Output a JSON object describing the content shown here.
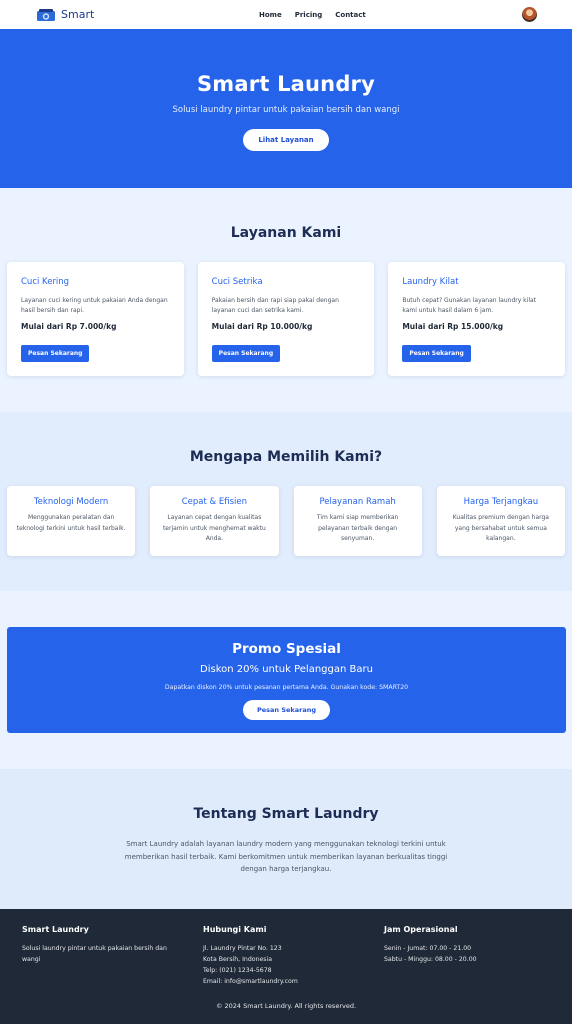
{
  "nav": {
    "brand": "Smart",
    "links": [
      "Home",
      "Pricing",
      "Contact"
    ]
  },
  "hero": {
    "title": "Smart Laundry",
    "subtitle": "Solusi laundry pintar untuk pakaian bersih dan wangi",
    "button": "Lihat Layanan"
  },
  "services": {
    "title": "Layanan Kami",
    "items": [
      {
        "name": "Cuci Kering",
        "desc": "Layanan cuci kering untuk pakaian Anda dengan hasil bersih dan rapi.",
        "price": "Mulai dari Rp 7.000/kg",
        "button": "Pesan Sekarang"
      },
      {
        "name": "Cuci Setrika",
        "desc": "Pakaian bersih dan rapi siap pakai dengan layanan cuci dan setrika kami.",
        "price": "Mulai dari Rp 10.000/kg",
        "button": "Pesan Sekarang"
      },
      {
        "name": "Laundry Kilat",
        "desc": "Butuh cepat? Gunakan layanan laundry kilat kami untuk hasil dalam 6 jam.",
        "price": "Mulai dari Rp 15.000/kg",
        "button": "Pesan Sekarang"
      }
    ]
  },
  "why": {
    "title": "Mengapa Memilih Kami?",
    "items": [
      {
        "name": "Teknologi Modern",
        "desc": "Menggunakan peralatan dan teknologi terkini untuk hasil terbaik."
      },
      {
        "name": "Cepat & Efisien",
        "desc": "Layanan cepat dengan kualitas terjamin untuk menghemat waktu Anda."
      },
      {
        "name": "Pelayanan Ramah",
        "desc": "Tim kami siap memberikan pelayanan terbaik dengan senyuman."
      },
      {
        "name": "Harga Terjangkau",
        "desc": "Kualitas premium dengan harga yang bersahabat untuk semua kalangan."
      }
    ]
  },
  "promo": {
    "title": "Promo Spesial",
    "subtitle": "Diskon 20% untuk Pelanggan Baru",
    "desc": "Dapatkan diskon 20% untuk pesanan pertama Anda. Gunakan kode: SMART20",
    "button": "Pesan Sekarang"
  },
  "about": {
    "title": "Tentang Smart Laundry",
    "text": "Smart Laundry adalah layanan laundry modern yang menggunakan teknologi terkini untuk memberikan hasil terbaik. Kami berkomitmen untuk memberikan layanan berkualitas tinggi dengan harga terjangkau."
  },
  "footer": {
    "col1": {
      "title": "Smart Laundry",
      "text": "Solusi laundry pintar untuk pakaian bersih dan wangi"
    },
    "col2": {
      "title": "Hubungi Kami",
      "lines": [
        "Jl. Laundry Pintar No. 123",
        "Kota Bersih, Indonesia",
        "Telp: (021) 1234-5678",
        "Email: info@smartlaundry.com"
      ]
    },
    "col3": {
      "title": "Jam Operasional",
      "lines": [
        "Senin - Jumat: 07.00 - 21.00",
        "Sabtu - Minggu: 08.00 - 20.00"
      ]
    },
    "copyright": "© 2024 Smart Laundry. All rights reserved."
  },
  "colors": {
    "primary": "#2563eb",
    "footer": "#1f2937"
  },
  "icons": {
    "logo": "laundry-machine-logo",
    "avatar": "user-avatar"
  }
}
